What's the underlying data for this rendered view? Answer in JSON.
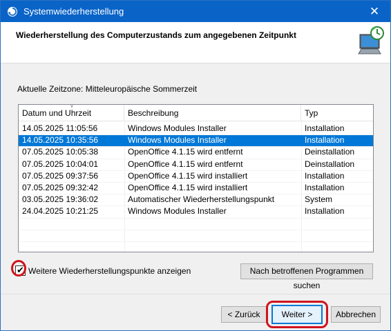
{
  "window": {
    "title": "Systemwiederherstellung",
    "close_glyph": "✕",
    "title_icon": "system-restore-icon",
    "title_bar_color": "#0a64c8"
  },
  "header": {
    "title": "Wiederherstellung des Computerzustands zum angegebenen Zeitpunkt",
    "icon": "restore-computer-icon"
  },
  "timezone_text": "Aktuelle Zeitzone: Mitteleuropäische Sommerzeit",
  "table": {
    "columns": [
      "Datum und Uhrzeit",
      "Beschreibung",
      "Typ"
    ],
    "sorted_column": "Datum und Uhrzeit",
    "rows": [
      {
        "date": "14.05.2025 11:05:56",
        "description": "Windows Modules Installer",
        "type": "Installation",
        "selected": false
      },
      {
        "date": "14.05.2025 10:35:56",
        "description": "Windows Modules Installer",
        "type": "Installation",
        "selected": true
      },
      {
        "date": "07.05.2025 10:05:38",
        "description": "OpenOffice 4.1.15 wird entfernt",
        "type": "Deinstallation",
        "selected": false
      },
      {
        "date": "07.05.2025 10:04:01",
        "description": "OpenOffice 4.1.15 wird entfernt",
        "type": "Deinstallation",
        "selected": false
      },
      {
        "date": "07.05.2025 09:37:56",
        "description": "OpenOffice 4.1.15 wird installiert",
        "type": "Installation",
        "selected": false
      },
      {
        "date": "07.05.2025 09:32:42",
        "description": "OpenOffice 4.1.15 wird installiert",
        "type": "Installation",
        "selected": false
      },
      {
        "date": "03.05.2025 19:36:02",
        "description": "Automatischer Wiederherstellungspunkt",
        "type": "System",
        "selected": false
      },
      {
        "date": "24.04.2025 10:21:25",
        "description": "Windows Modules Installer",
        "type": "Installation",
        "selected": false
      }
    ],
    "selection_color": "#0078d7"
  },
  "more_points": {
    "label": "Weitere Wiederherstellungspunkte anzeigen",
    "checked": true,
    "check_glyph": "✔"
  },
  "buttons": {
    "search_programs": "Nach betroffenen Programmen suchen",
    "back": "< Zurück",
    "next": "Weiter >",
    "cancel": "Abbrechen"
  },
  "annotations": {
    "highlight_color": "#d0131c",
    "highlighted": [
      "more-points-checkbox",
      "next-button"
    ]
  }
}
